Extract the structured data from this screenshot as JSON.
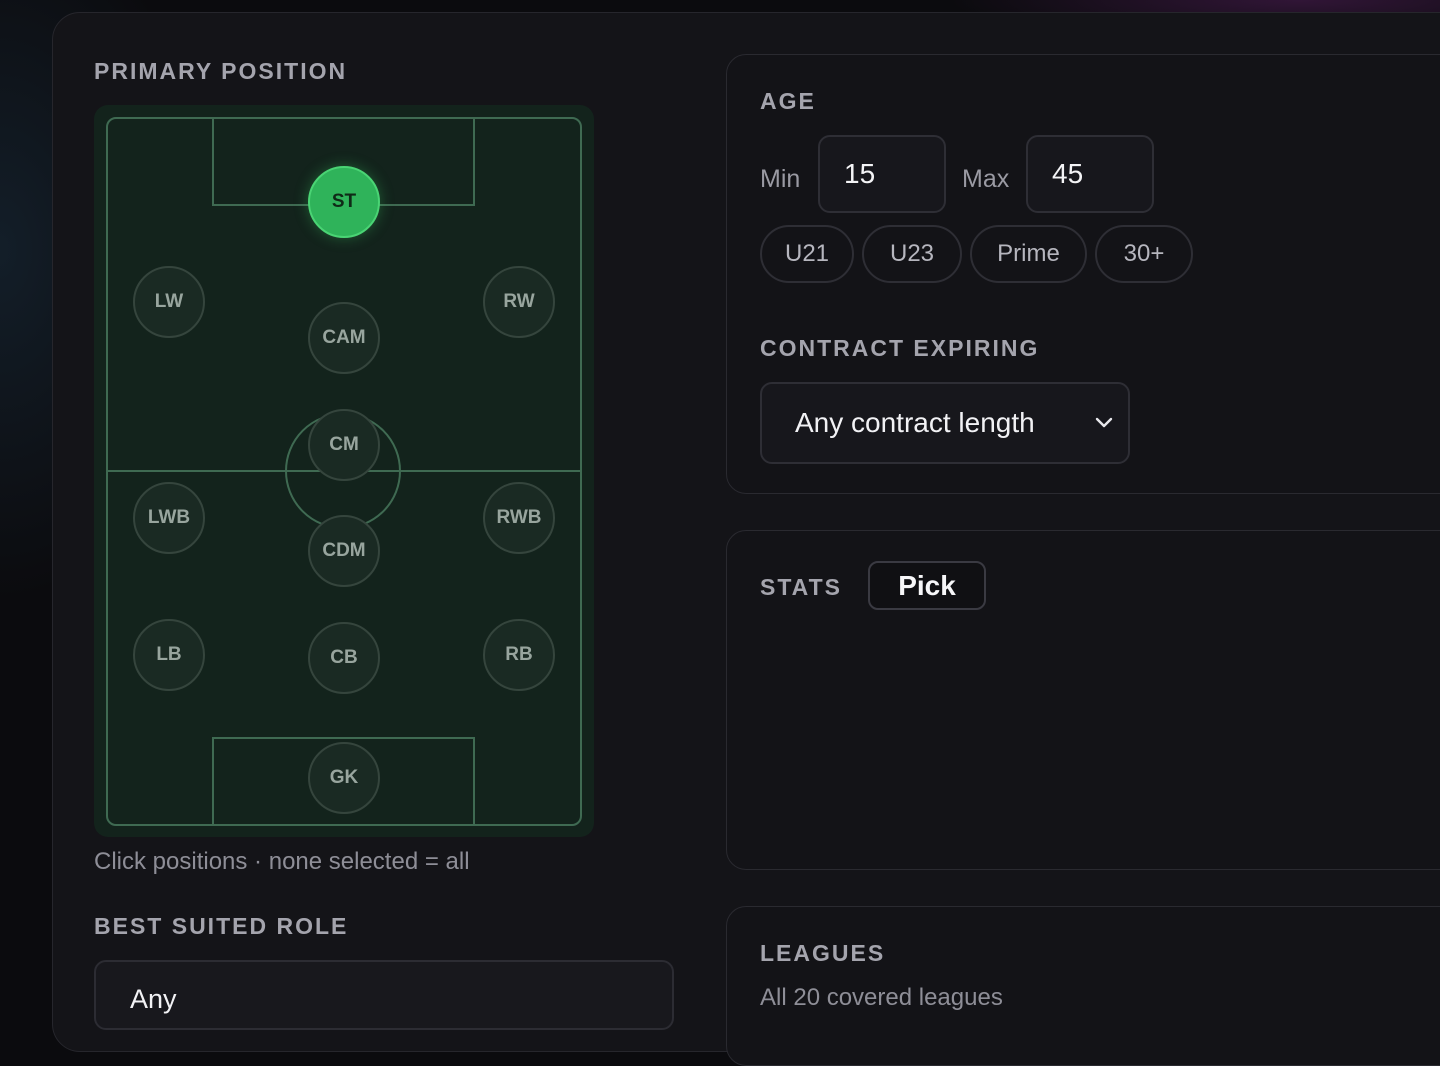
{
  "primary_position": {
    "label": "PRIMARY POSITION",
    "positions": [
      "ST",
      "LW",
      "RW",
      "CAM",
      "CM",
      "LWB",
      "RWB",
      "CDM",
      "LB",
      "CB",
      "RB",
      "GK"
    ],
    "selected": "ST",
    "hint": "Click positions · none selected = all"
  },
  "best_suited_role": {
    "label": "BEST SUITED ROLE",
    "value": "Any"
  },
  "age": {
    "label": "AGE",
    "min_label": "Min",
    "min_value": "15",
    "max_label": "Max",
    "max_value": "45",
    "presets": [
      "U21",
      "U23",
      "Prime",
      "30+"
    ]
  },
  "contract": {
    "label": "CONTRACT EXPIRING",
    "value": "Any contract length"
  },
  "stats": {
    "label": "STATS",
    "pick_label": "Pick"
  },
  "leagues": {
    "label": "LEAGUES",
    "subtitle": "All 20 covered leagues"
  },
  "colors": {
    "accent_green": "#2fb35a",
    "pitch": "#13231c",
    "panel": "#141418"
  }
}
